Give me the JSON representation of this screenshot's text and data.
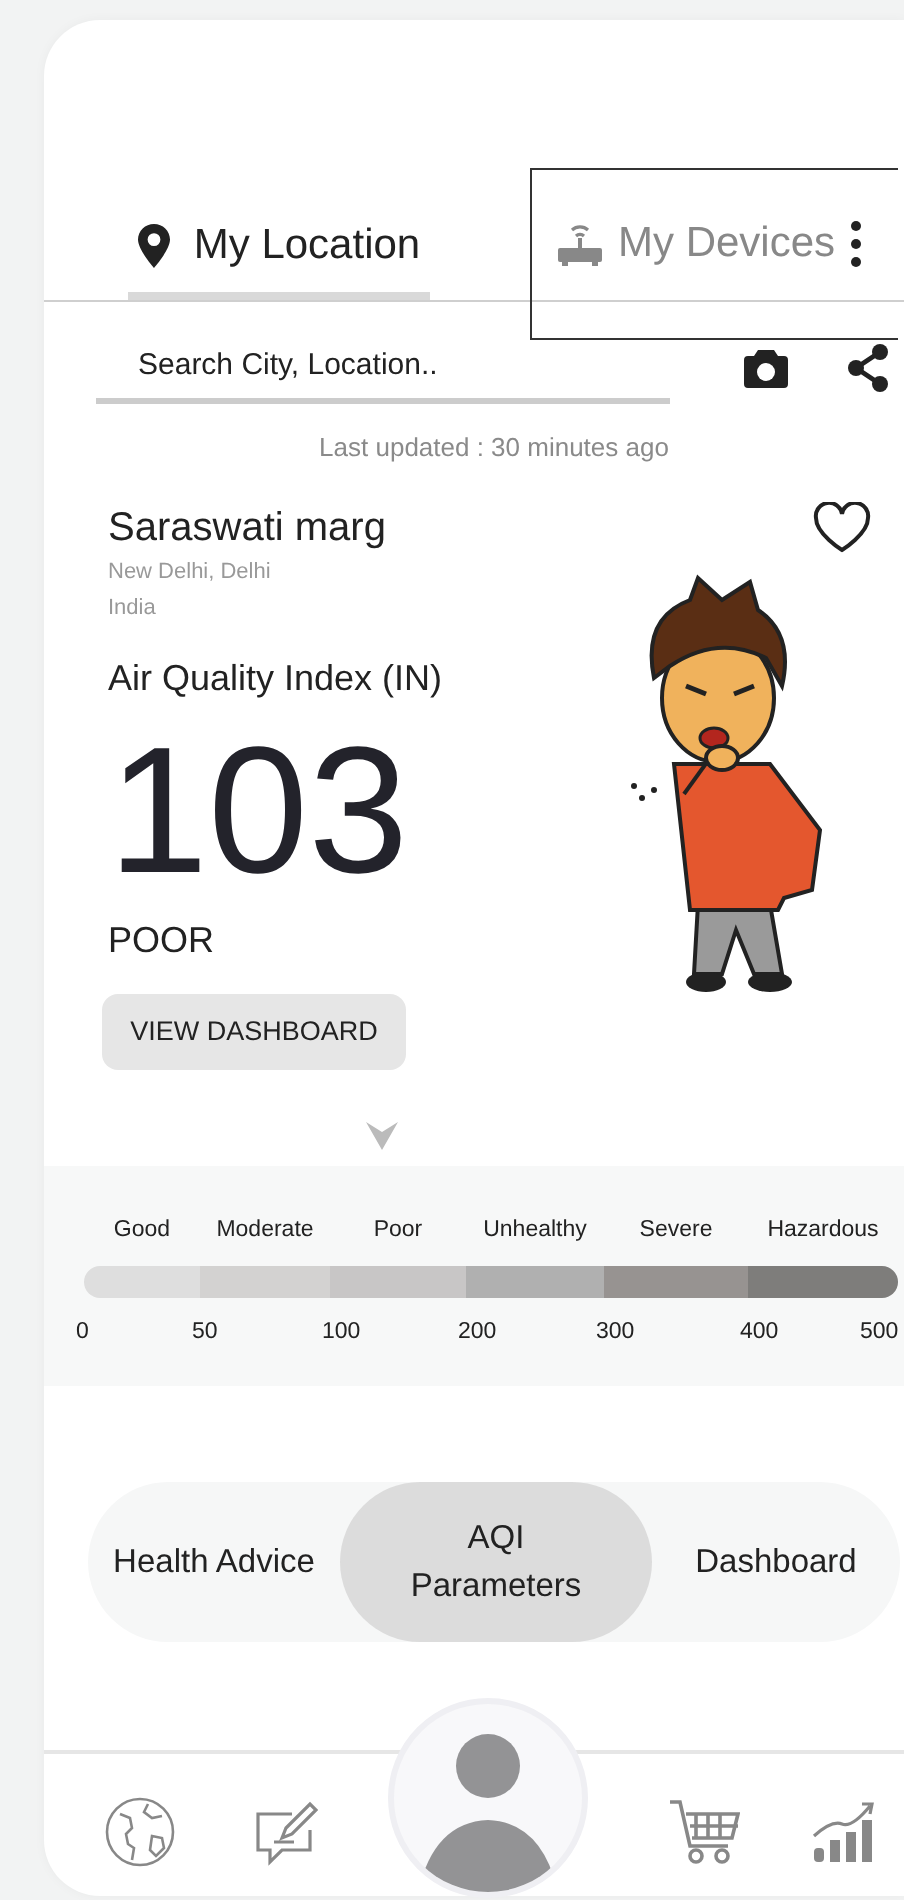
{
  "tabs": [
    {
      "label": "My Location",
      "selected": true,
      "focused": false
    },
    {
      "label": "My Devices",
      "selected": false,
      "focused": true
    }
  ],
  "search": {
    "placeholder": "Search City, Location.."
  },
  "last_updated": "Last updated : 30 minutes ago",
  "location": {
    "name": "Saraswati marg",
    "region": "New Delhi, Delhi",
    "country": "India",
    "favorite": false
  },
  "aqi": {
    "title": "Air Quality Index (IN)",
    "value": "103",
    "category": "POOR",
    "button": "VIEW DASHBOARD"
  },
  "scale": {
    "categories": [
      {
        "label": "Good",
        "color": "#dedede"
      },
      {
        "label": "Moderate",
        "color": "#d3d2d1"
      },
      {
        "label": "Poor",
        "color": "#c8c6c6"
      },
      {
        "label": "Unhealthy",
        "color": "#b0b0b0"
      },
      {
        "label": "Severe",
        "color": "#979391"
      },
      {
        "label": "Hazardous",
        "color": "#7e7d7b"
      }
    ],
    "ticks": [
      "0",
      "50",
      "100",
      "200",
      "300",
      "400",
      "500"
    ]
  },
  "segments": [
    {
      "label": "Health Advice",
      "selected": false
    },
    {
      "label": "AQI Parameters",
      "selected": true
    },
    {
      "label": "Dashboard",
      "selected": false
    }
  ]
}
